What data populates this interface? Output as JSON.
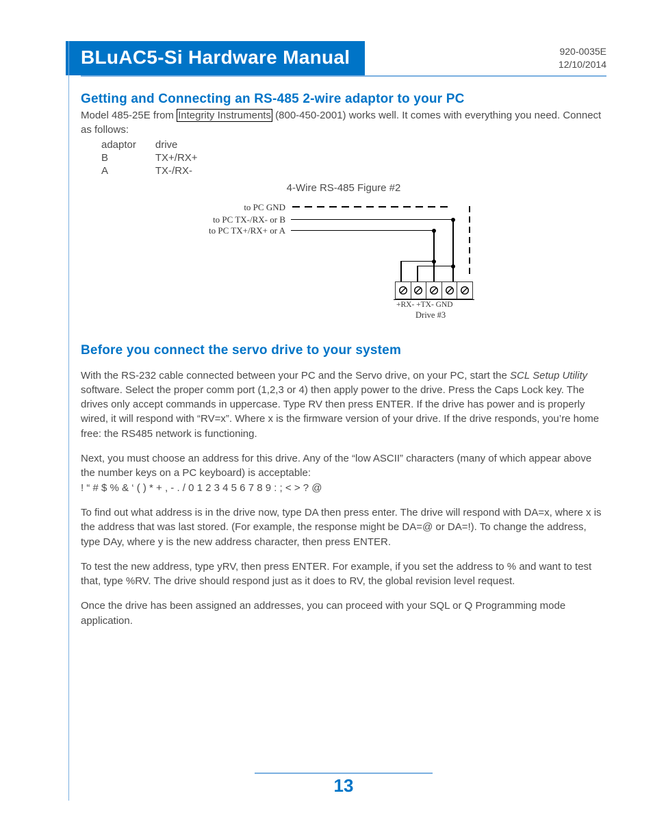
{
  "header": {
    "title": "BLuAC5-Si Hardware Manual",
    "doc_number": "920-0035E",
    "doc_date": "12/10/2014"
  },
  "sect1": {
    "heading": "Getting and Connecting an RS-485 2-wire adaptor to your PC",
    "p_prefix": "Model 485-25E from ",
    "link_text": "Integrity Instruments",
    "p_suffix": " (800-450-2001) works well.  It comes with everything you need. Connect as follows:",
    "tbl": {
      "h1": "adaptor",
      "h2": "drive",
      "r1c1": "B",
      "r1c2": "TX+/RX+",
      "r2c1": "A",
      "r2c2": "TX-/RX-"
    },
    "figcap": "4-Wire RS-485 Figure #2"
  },
  "diagram": {
    "l_gnd": "to PC GND",
    "l_b": "to PC TX-/RX- or B",
    "l_a": "to PC TX+/RX+ or A",
    "pins": "+RX-  +TX-  GND",
    "drive": "Drive #3"
  },
  "sect2": {
    "heading": "Before you connect the servo drive to your system",
    "p1a": "With the RS-232 cable connected between your PC and the Servo drive, on your PC, start the ",
    "p1ital": "SCL Setup Utility",
    "p1b": " software. Select the proper comm port (1,2,3 or 4) then apply power   to the drive.  Press the Caps Lock key.  The drives only accept commands in uppercase.  Type RV then press ENTER.  If the drive has power and is properly wired, it will respond with “RV=x”.  Where x is the firmware version of your drive.  If the drive responds, you’re home free:  the RS485 network is functioning.",
    "p2": "Next, you must choose an address for this drive.  Any of the “low ASCII” characters (many of which appear above the number keys on a PC keyboard) is acceptable:",
    "chars": "  ! “ # $ % & ‘ ( ) * + , - . / 0 1 2 3 4 5 6 7 8 9 : ; < > ? @",
    "p3": "To find out what address is in the drive now, type DA then press enter.  The drive will respond with DA=x, where x is the address that was last stored.  (For example, the response might be DA=@ or DA=!).  To change the address, type DAy, where y is the new address character, then press ENTER.",
    "p4": "To test the new address, type yRV, then press ENTER.  For example, if you set the address to % and want to test that, type %RV.  The drive should respond just as it does to RV, the global revision level request.",
    "p5": "Once the drive has been assigned an addresses, you can proceed with your SQL or Q Programming mode application."
  },
  "page_number": "13"
}
